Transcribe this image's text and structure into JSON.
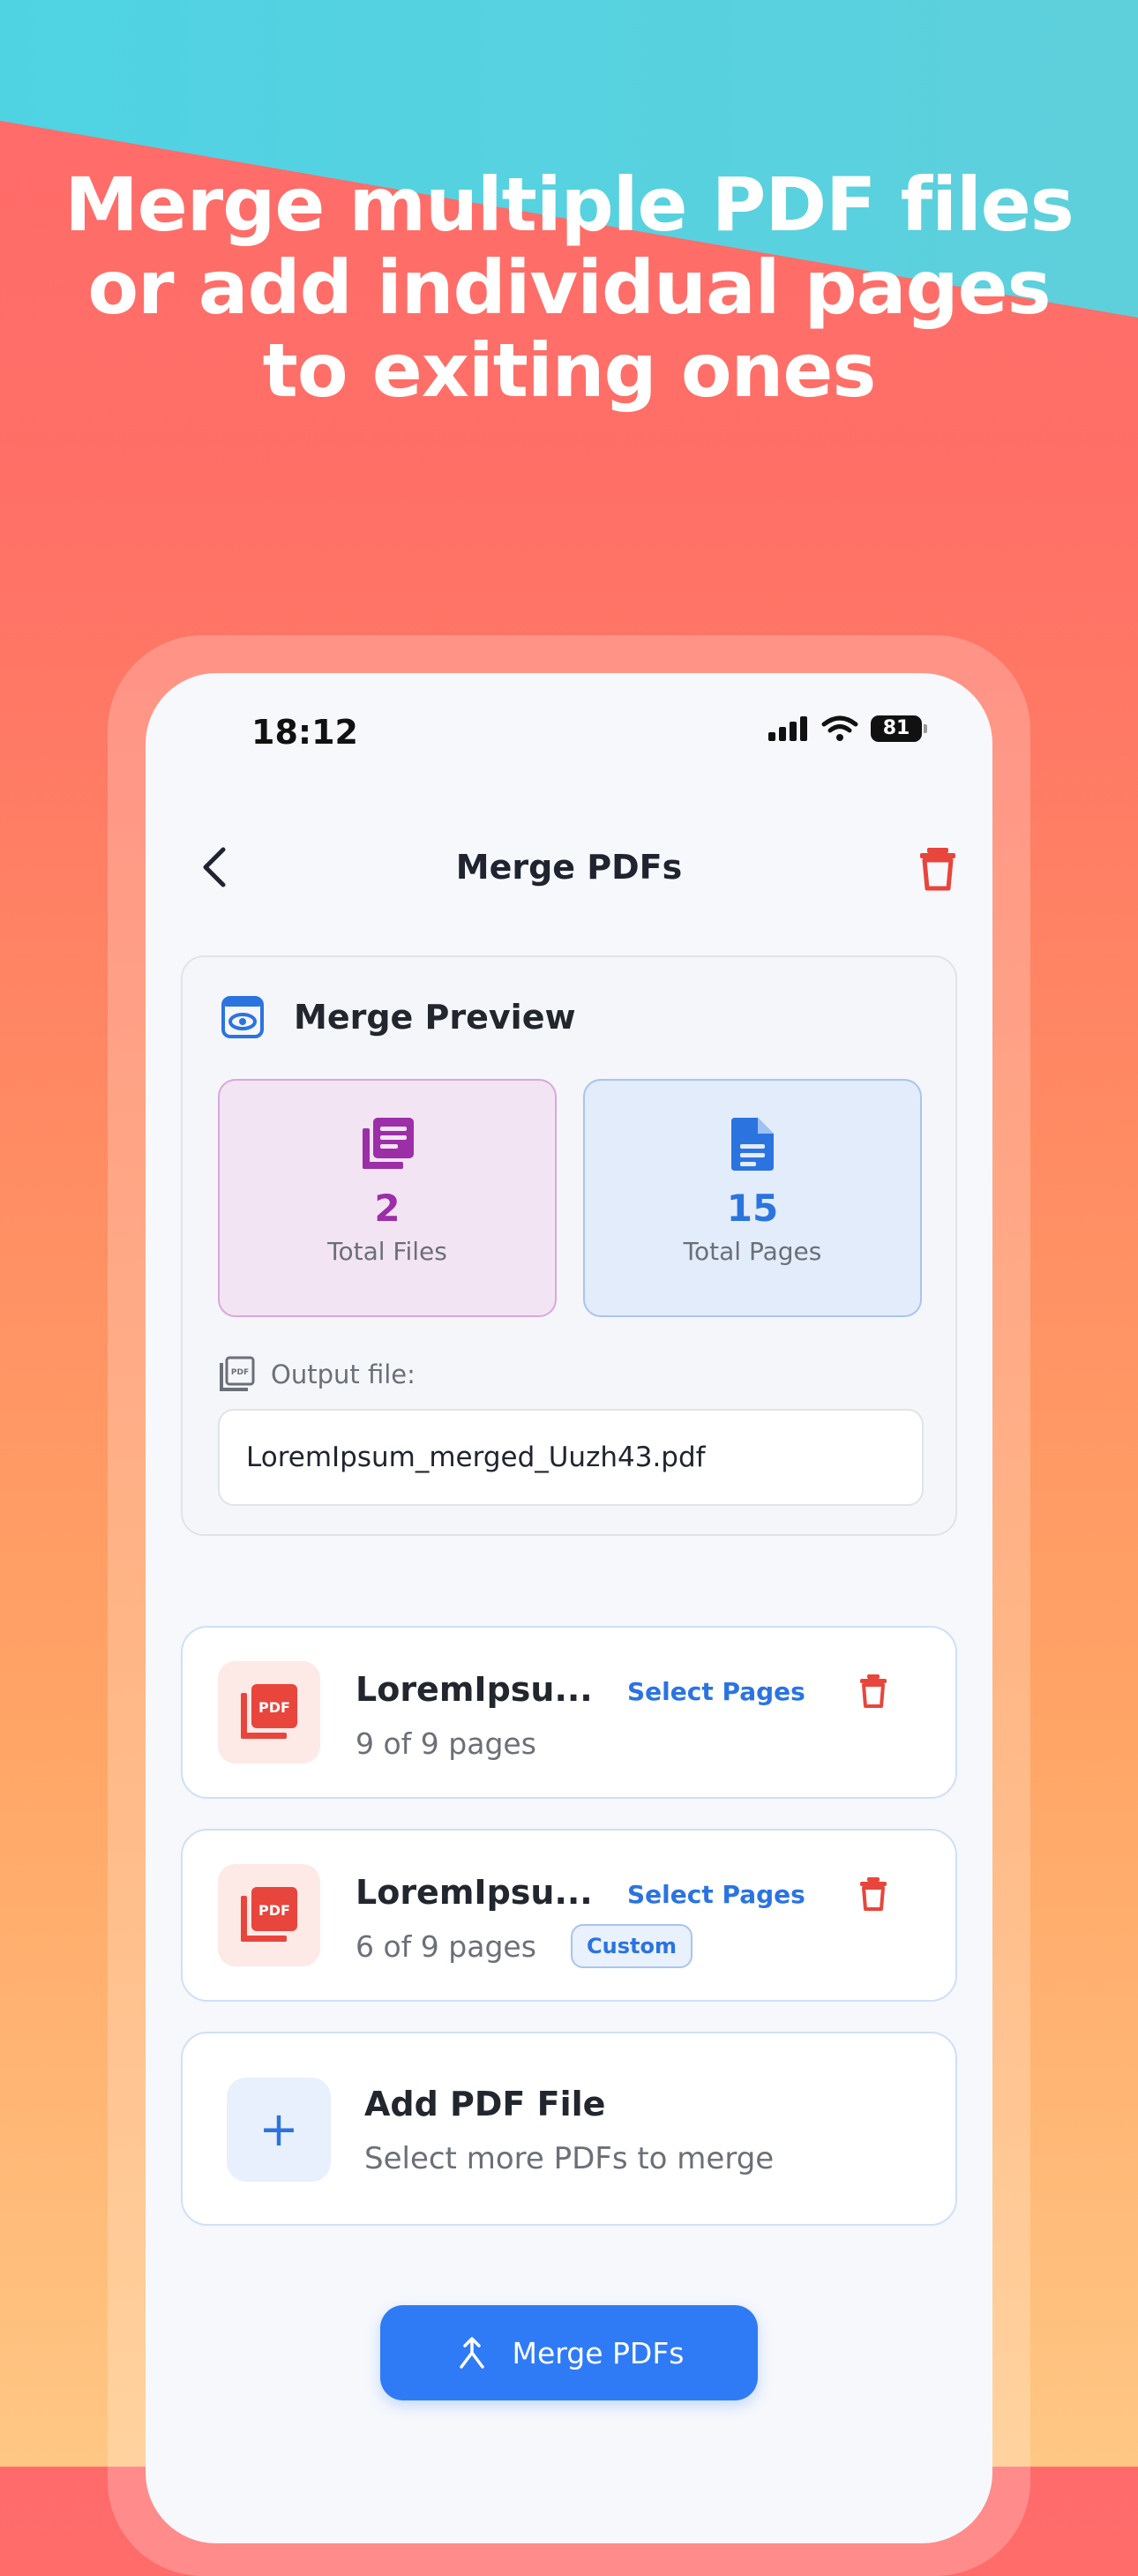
{
  "marketing": {
    "headline_line1": "Merge multiple PDF files",
    "headline_line2": "or add individual pages",
    "headline_line3": "to exiting ones"
  },
  "status_bar": {
    "time": "18:12",
    "battery": "81"
  },
  "nav": {
    "title": "Merge PDFs"
  },
  "preview": {
    "title": "Merge Preview",
    "files_value": "2",
    "files_label": "Total Files",
    "pages_value": "15",
    "pages_label": "Total Pages",
    "output_label": "Output file:",
    "output_filename": "LoremIpsum_merged_Uuzh43.pdf"
  },
  "files": [
    {
      "name": "LoremIpsu...",
      "pages": "9 of 9 pages",
      "select_label": "Select Pages",
      "badge": ""
    },
    {
      "name": "LoremIpsu...",
      "pages": "6 of 9 pages",
      "select_label": "Select Pages",
      "badge": "Custom"
    }
  ],
  "add_file": {
    "title": "Add PDF File",
    "subtitle": "Select more PDFs to merge"
  },
  "merge_button": {
    "label": "Merge PDFs"
  },
  "icons": {
    "pdf_icon_text": "PDF",
    "add": "+"
  },
  "colors": {
    "accent_blue": "#2f7bf6",
    "danger_red": "#e8453c",
    "files_purple": "#9c2ea8"
  }
}
